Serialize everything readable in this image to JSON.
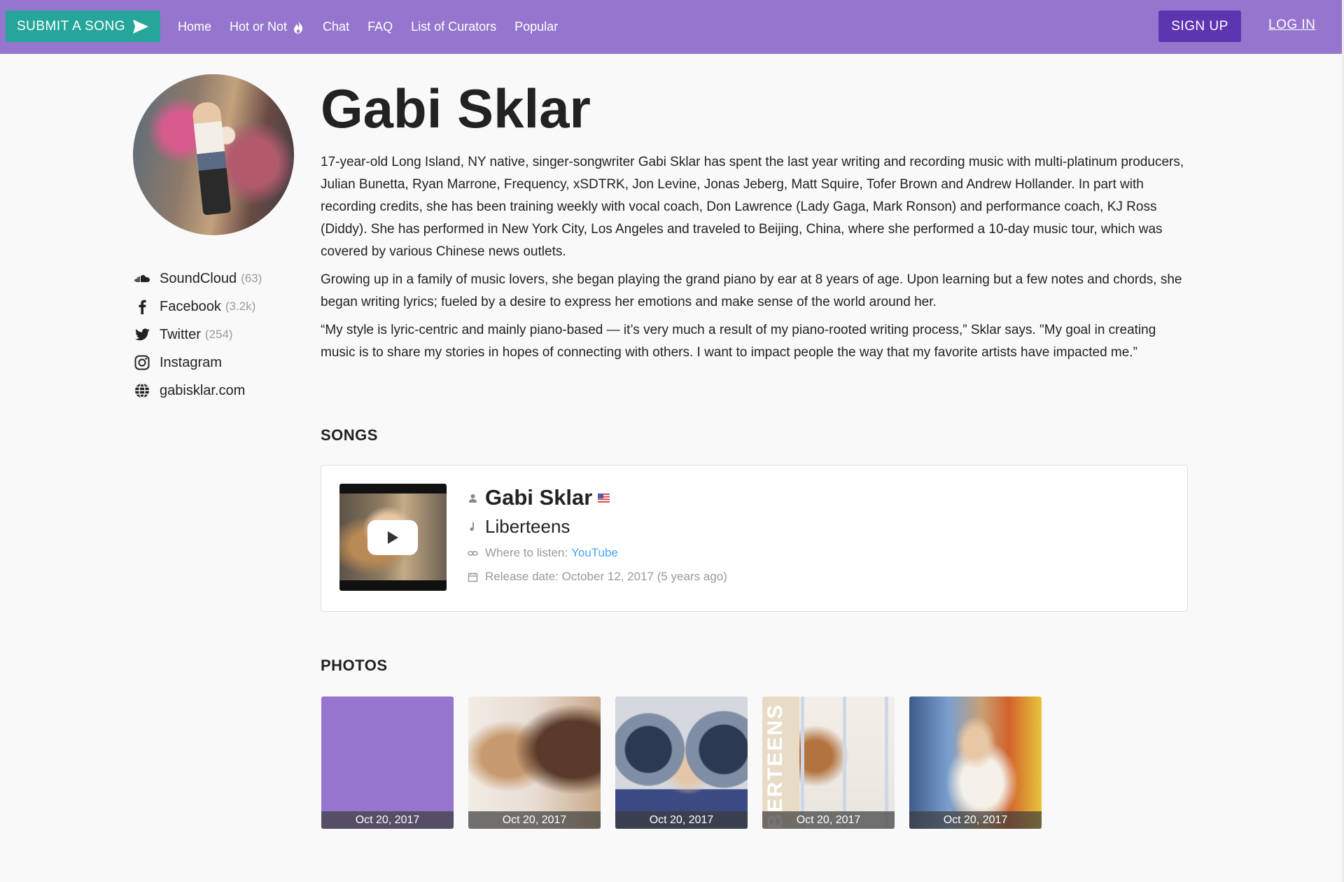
{
  "nav": {
    "submit_label": "SUBMIT A SONG",
    "links": [
      "Home",
      "Hot or Not",
      "Chat",
      "FAQ",
      "List of Curators",
      "Popular"
    ],
    "signup_label": "SIGN UP",
    "login_label": "LOG IN"
  },
  "artist": {
    "name": "Gabi Sklar",
    "bio": [
      "17-year-old Long Island, NY native, singer-songwriter Gabi Sklar has spent the last year writing and recording music with multi-platinum producers, Julian Bunetta, Ryan Marrone, Frequency, xSDTRK, Jon Levine, Jonas Jeberg, Matt Squire, Tofer Brown and Andrew Hollander. In part with recording credits, she has been training weekly with vocal coach, Don Lawrence (Lady Gaga, Mark Ronson) and performance coach, KJ Ross (Diddy). She has performed in New York City, Los Angeles and traveled to Beijing, China, where she performed a 10-day music tour, which was covered by various Chinese news outlets.",
      "Growing up in a family of music lovers, she began playing the grand piano by ear at 8 years of age. Upon learning but a few notes and chords, she began writing lyrics; fueled by a desire to express her emotions and make sense of the world around her.",
      "“My style is lyric-centric and mainly piano-based — it’s very much a result of my piano-rooted writing process,” Sklar says. \"My goal in creating music is to share my stories in hopes of connecting with others. I want to impact people the way that my favorite artists have impacted me.”"
    ]
  },
  "social": [
    {
      "icon": "soundcloud-icon",
      "label": "SoundCloud",
      "count": "(63)"
    },
    {
      "icon": "facebook-icon",
      "label": "Facebook",
      "count": "(3.2k)"
    },
    {
      "icon": "twitter-icon",
      "label": "Twitter",
      "count": "(254)"
    },
    {
      "icon": "instagram-icon",
      "label": "Instagram",
      "count": ""
    },
    {
      "icon": "globe-icon",
      "label": "gabisklar.com",
      "count": ""
    }
  ],
  "songs": {
    "heading": "SONGS",
    "items": [
      {
        "artist": "Gabi Sklar",
        "title": "Liberteens",
        "listen_label": "Where to listen:",
        "listen_link": "YouTube",
        "release": "Release date: October 12, 2017 (5 years ago)"
      }
    ]
  },
  "photos": {
    "heading": "PHOTOS",
    "items": [
      {
        "date": "Oct 20, 2017"
      },
      {
        "date": "Oct 20, 2017"
      },
      {
        "date": "Oct 20, 2017"
      },
      {
        "date": "Oct 20, 2017",
        "overlay_text": "LIBERTEENS"
      },
      {
        "date": "Oct 20, 2017"
      }
    ]
  },
  "colors": {
    "nav_bg": "#9575cd",
    "submit_bg": "#26a69a",
    "signup_bg": "#5e35b1",
    "link": "#42a5f5"
  }
}
